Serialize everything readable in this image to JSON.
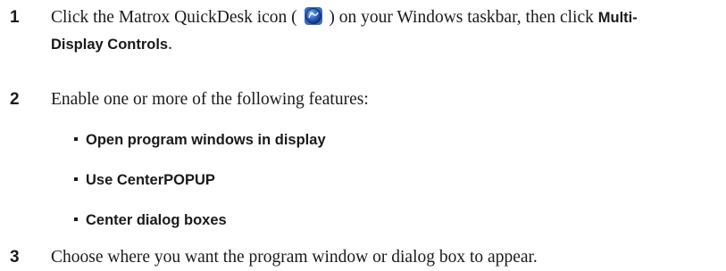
{
  "steps": [
    {
      "number": "1",
      "text_before": "Click the Matrox QuickDesk icon (",
      "icon": "matrox-quickdesk-icon",
      "text_after": ") on your Windows taskbar, then click",
      "bold_line1": "Multi-",
      "bold_line2": "Display Controls",
      "end": "."
    },
    {
      "number": "2",
      "text": "Enable one or more of the following features:"
    },
    {
      "number": "3",
      "text": "Choose where you want the program window or dialog box to appear."
    }
  ],
  "features": [
    "Open program windows in display",
    "Use CenterPOPUP",
    "Center dialog boxes"
  ]
}
